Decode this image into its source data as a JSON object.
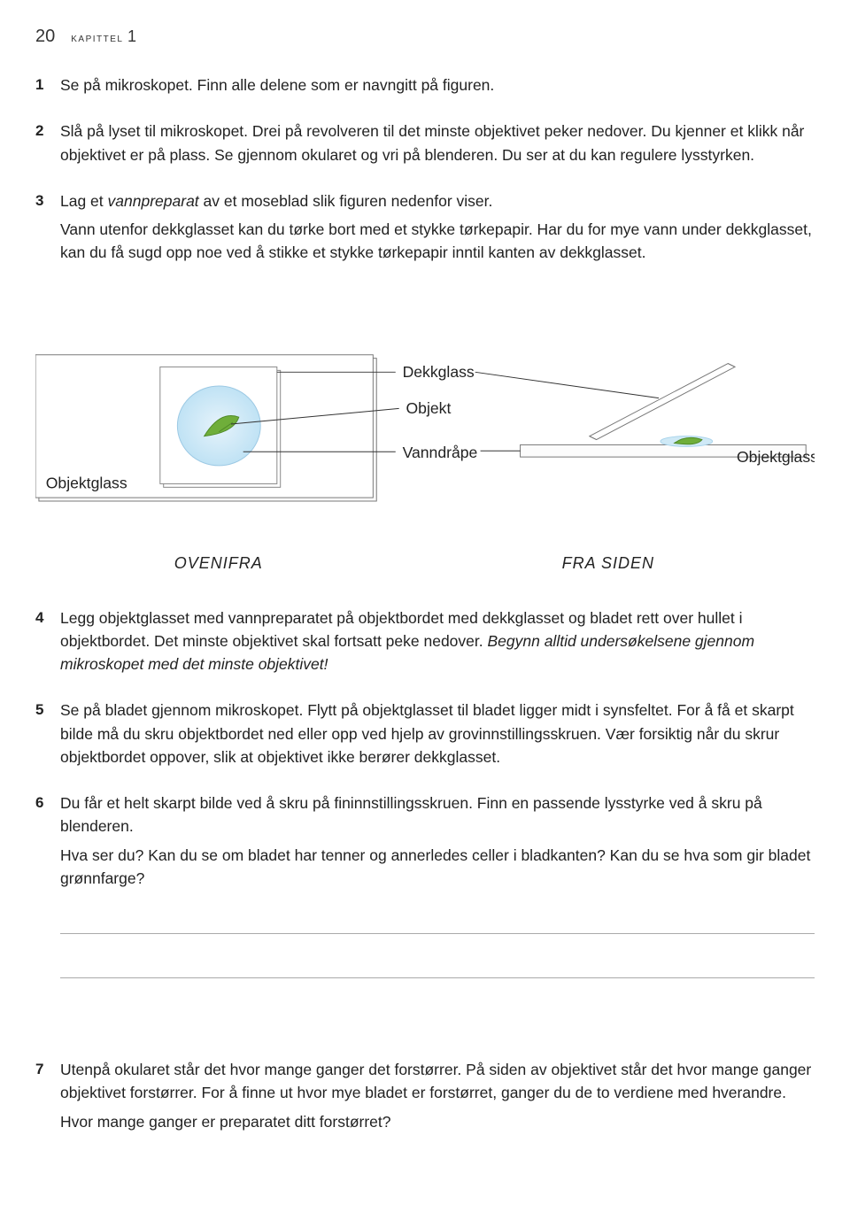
{
  "header": {
    "page_number": "20",
    "chapter_word": "kapittel",
    "chapter_number": "1"
  },
  "items": [
    {
      "num": "1",
      "paragraphs": [
        {
          "runs": [
            {
              "t": "Se på mikroskopet. Finn alle delene som er navngitt på figuren."
            }
          ]
        }
      ]
    },
    {
      "num": "2",
      "paragraphs": [
        {
          "runs": [
            {
              "t": "Slå på lyset til mikroskopet. Drei på revolveren til det minste objektivet peker nedover. Du kjenner et klikk når objektivet er på plass. Se gjennom okularet og vri på blenderen. Du ser at du kan regulere lysstyrken."
            }
          ]
        }
      ]
    },
    {
      "num": "3",
      "paragraphs": [
        {
          "runs": [
            {
              "t": "Lag et "
            },
            {
              "t": "vannpreparat",
              "em": true
            },
            {
              "t": " av et moseblad slik figuren nedenfor viser."
            }
          ]
        },
        {
          "runs": [
            {
              "t": "Vann utenfor dekkglasset kan du tørke bort med et stykke tørkepapir. Har du for mye vann under dekkglasset, kan du få sugd opp noe ved å stikke et stykke tørkepapir inntil kanten av dekkglasset."
            }
          ]
        }
      ]
    }
  ],
  "figure": {
    "labels": {
      "dekkglass": "Dekkglass",
      "objekt": "Objekt",
      "vanndrape": "Vanndråpe",
      "objektglass_left": "Objektglass",
      "objektglass_right": "Objektglass"
    },
    "captions": {
      "left": "OVENIFRA",
      "right": "FRA SIDEN"
    }
  },
  "items2": [
    {
      "num": "4",
      "paragraphs": [
        {
          "runs": [
            {
              "t": "Legg objektglasset med vannpreparatet på objektbordet med dekkglasset og bladet rett over hullet i objektbordet. Det minste objektivet skal fortsatt peke nedover. "
            },
            {
              "t": "Begynn alltid undersøkelsene gjennom mikroskopet med det minste objektivet!",
              "em": true
            }
          ]
        }
      ]
    },
    {
      "num": "5",
      "paragraphs": [
        {
          "runs": [
            {
              "t": "Se på bladet gjennom mikroskopet. Flytt på objektglasset til bladet ligger midt i synsfeltet. For å få et skarpt bilde må du skru objektbordet ned eller opp ved hjelp av grovinnstillingsskruen. Vær forsiktig når du skrur objektbordet oppover, slik at objektivet ikke berører dekkglasset."
            }
          ]
        }
      ]
    },
    {
      "num": "6",
      "paragraphs": [
        {
          "runs": [
            {
              "t": "Du får et helt skarpt bilde ved å skru på fininnstillingsskruen. Finn en passende lysstyrke ved å skru på blenderen."
            }
          ]
        },
        {
          "runs": [
            {
              "t": "Hva ser du? Kan du se om bladet har tenner og annerledes celler i bladkanten? Kan du se hva som gir bladet grønnfarge?"
            }
          ]
        }
      ],
      "answer_lines": 2
    }
  ],
  "items3": [
    {
      "num": "7",
      "paragraphs": [
        {
          "runs": [
            {
              "t": "Utenpå okularet står det hvor mange ganger det forstørrer. På siden av objektivet står det hvor mange ganger objektivet forstørrer. For å finne ut hvor mye bladet er forstørret, ganger du de to verdiene med hverandre."
            }
          ]
        },
        {
          "runs": [
            {
              "t": "Hvor mange ganger er preparatet ditt forstørret?"
            }
          ]
        }
      ]
    }
  ]
}
